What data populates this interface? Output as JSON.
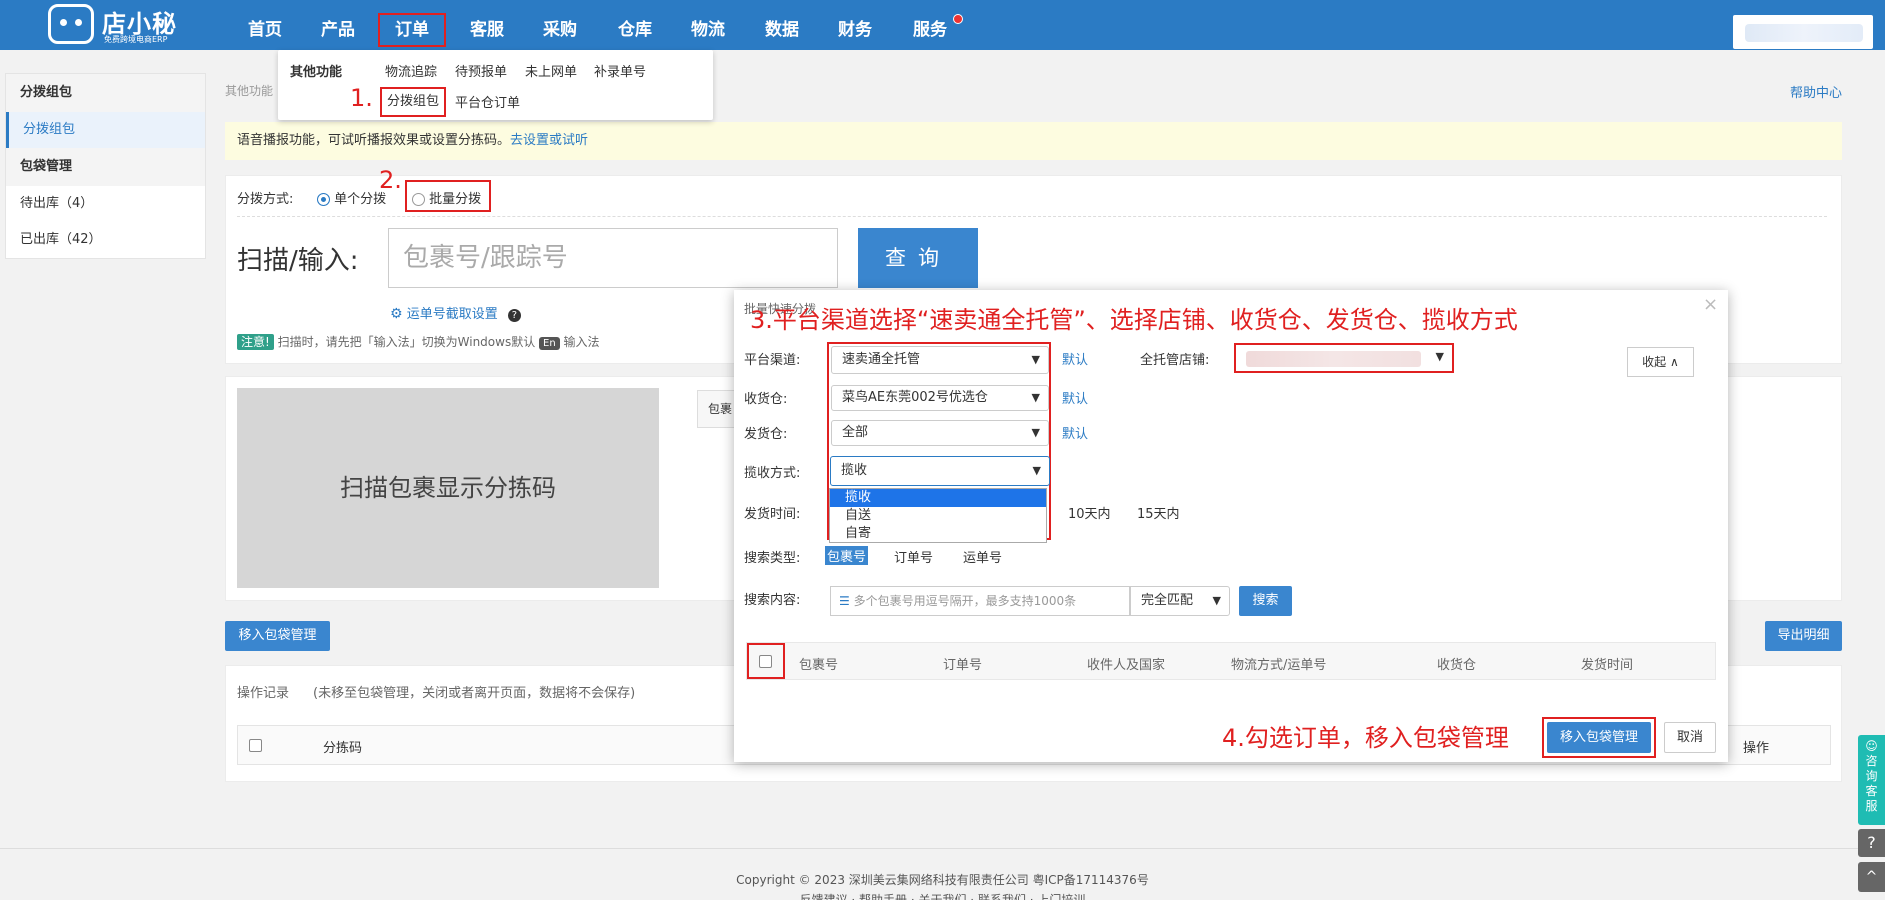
{
  "logo": {
    "brand": "店小秘",
    "sub": "免费跨境电商ERP"
  },
  "nav": [
    "首页",
    "产品",
    "订单",
    "客服",
    "采购",
    "仓库",
    "物流",
    "数据",
    "财务",
    "服务"
  ],
  "menu": {
    "group": "其他功能",
    "row1": [
      "物流追踪",
      "待预报单",
      "未上网单",
      "补录单号"
    ],
    "row2": [
      "分拨组包",
      "平台仓订单"
    ]
  },
  "annotations": {
    "step1": "1.",
    "step2": "2.",
    "step3": "3.平台渠道选择“速卖通全托管”、选择店铺、收货仓、发货仓、揽收方式",
    "step4": "4.勾选订单，移入包袋管理"
  },
  "sidebar": {
    "head1": "分拨组包",
    "item1": "分拨组包",
    "head2": "包袋管理",
    "item2": "待出库（4）",
    "item3": "已出库（42）"
  },
  "crumb": "其他功能",
  "help": "帮助中心",
  "notice": {
    "text": "语音播报功能，可试听播报效果或设置分拣码。",
    "link": "去设置或试听"
  },
  "scan": {
    "mode_label": "分拨方式:",
    "mode_single": "单个分拨",
    "mode_batch": "批量分拨",
    "scan_label": "扫描/输入:",
    "placeholder": "包裹号/跟踪号",
    "query": "查询",
    "setting": "运单号截取设置",
    "note_badge": "注意!",
    "note_text": "扫描时，请先把「输入法」切换为Windows默认",
    "en_badge": "En",
    "note_tail": "输入法"
  },
  "codebox": "扫描包裹显示分拣码",
  "codetab": "包裹",
  "buttons": {
    "move_main": "移入包袋管理",
    "export": "导出明细"
  },
  "log": {
    "title": "操作记录",
    "hint": "(未移至包袋管理，关闭或者离开页面，数据将不会保存)",
    "col_code": "分拣码",
    "col_op": "操作"
  },
  "footer": {
    "line1": "Copyright © 2023 深圳美云集网络科技有限责任公司  粤ICP备17114376号",
    "line2": "反馈建议 · 帮助手册 · 关于我们 · 联系我们 · 上门培训"
  },
  "side_tools": {
    "consult": "咨询客服",
    "help": "?",
    "top": "^"
  },
  "modal": {
    "title": "批量快速分拨",
    "close": "×",
    "platform_label": "平台渠道:",
    "platform_value": "速卖通全托管",
    "default": "默认",
    "store_label": "全托管店铺:",
    "collapse": "收起",
    "recv_label": "收货仓:",
    "recv_value": "菜鸟AE东莞002号优选仓",
    "send_label": "发货仓:",
    "send_value": "全部",
    "pickup_label": "揽收方式:",
    "pickup_value": "揽收",
    "pickup_options": [
      "揽收",
      "自送",
      "自寄"
    ],
    "time_label": "发货时间:",
    "time_opts": [
      "10天内",
      "15天内"
    ],
    "search_type_label": "搜索类型:",
    "search_types": [
      "包裹号",
      "订单号",
      "运单号"
    ],
    "search_content_label": "搜索内容:",
    "search_placeholder": "多个包裹号用逗号隔开，最多支持1000条",
    "match": "完全匹配",
    "search_btn": "搜索",
    "columns": [
      "包裹号",
      "订单号",
      "收件人及国家",
      "物流方式/运单号",
      "收货仓",
      "发货时间"
    ],
    "move_btn": "移入包袋管理",
    "cancel_btn": "取消"
  }
}
